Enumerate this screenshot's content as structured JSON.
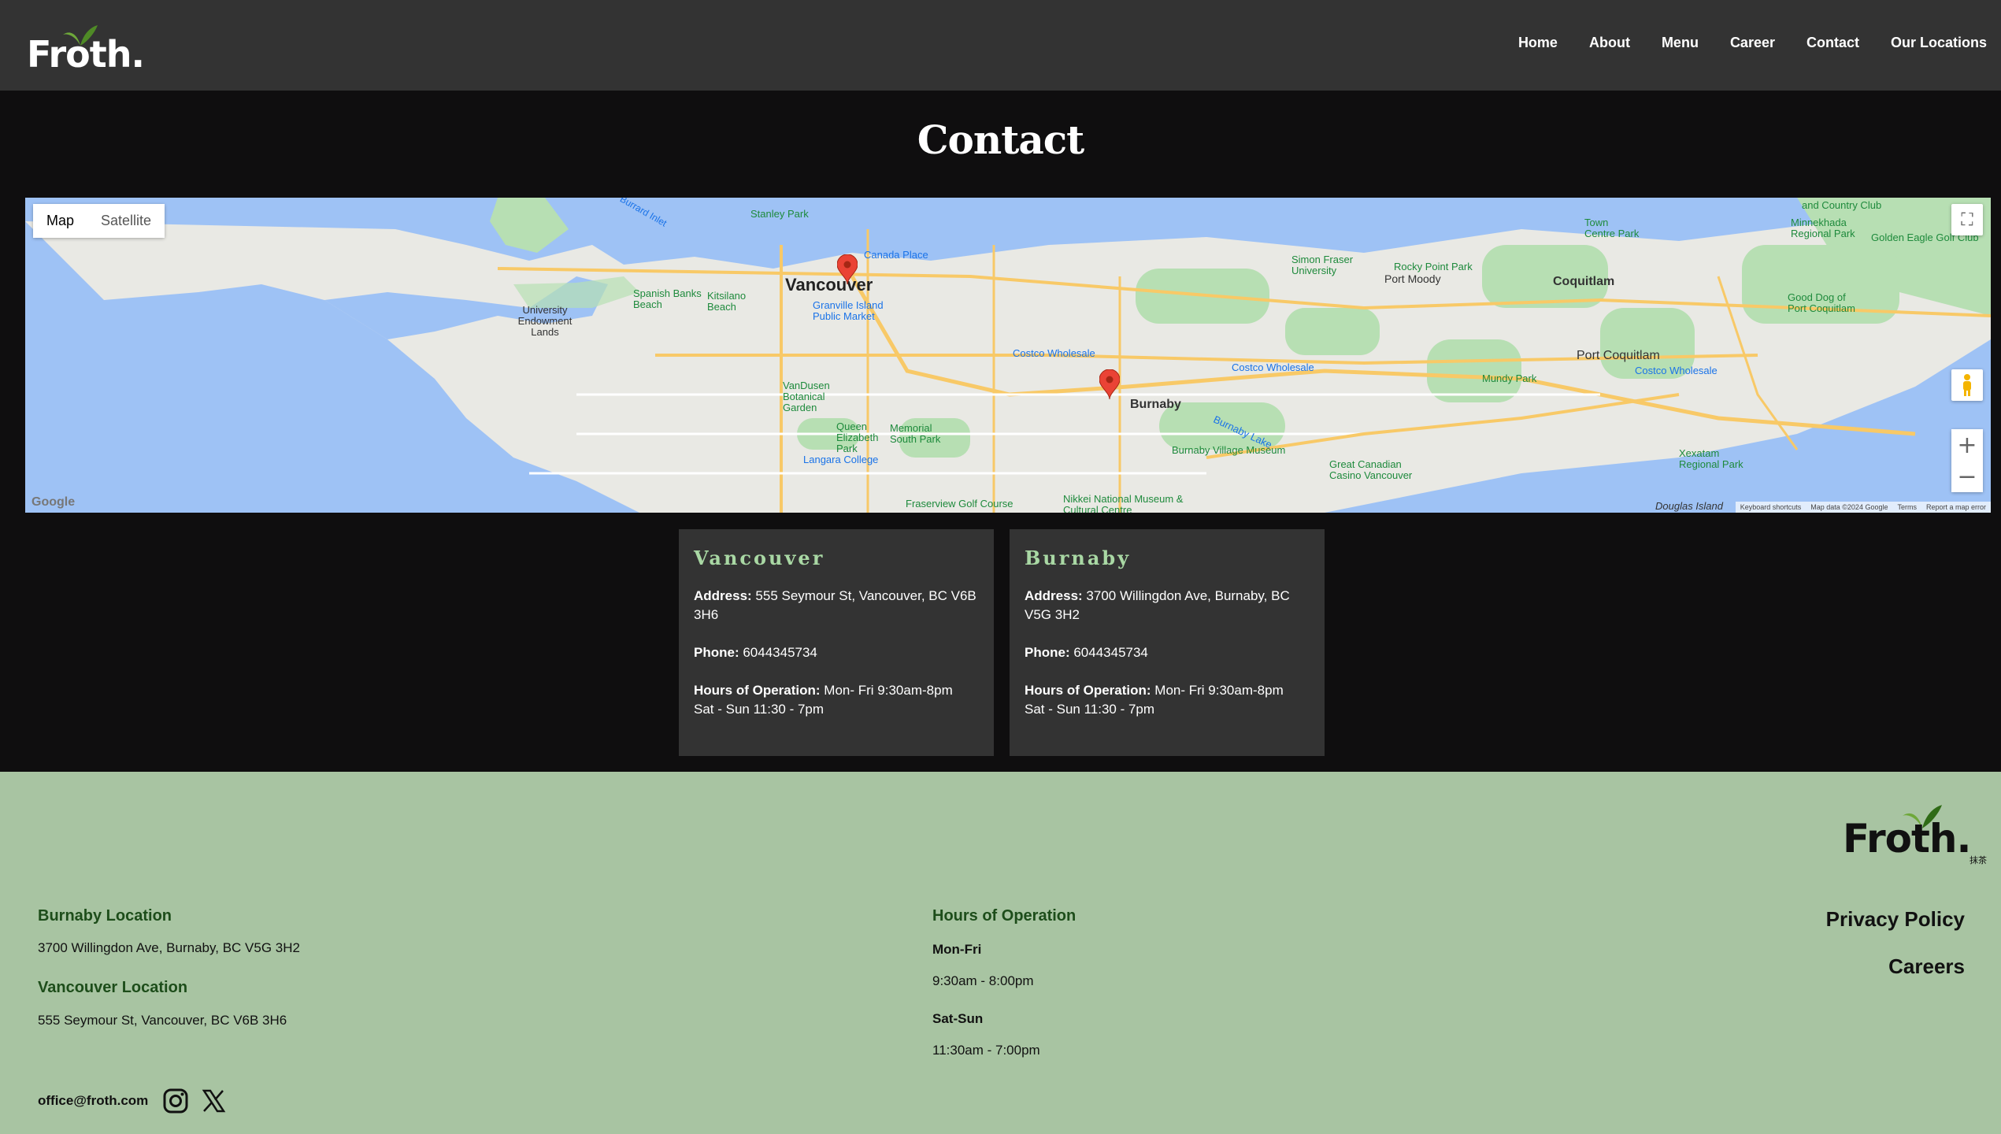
{
  "brand": {
    "name": "Froth.",
    "tagline": "抹茶"
  },
  "nav": {
    "items": [
      "Home",
      "About",
      "Menu",
      "Career",
      "Contact",
      "Our Locations"
    ]
  },
  "page": {
    "title": "Contact"
  },
  "map": {
    "type_map": "Map",
    "type_satellite": "Satellite",
    "attribution": [
      "Keyboard shortcuts",
      "Map data ©2024 Google",
      "Terms",
      "Report a map error"
    ],
    "google_logo": "Google",
    "labels": {
      "vancouver": "Vancouver",
      "burnaby": "Burnaby",
      "coquitlam": "Coquitlam",
      "port_coquitlam": "Port Coquitlam",
      "port_moody": "Port Moody",
      "ubc": "University Endowment Lands",
      "stanley": "Stanley Park",
      "canada_place": "Canada Place",
      "granville": "Granville Island Public Market",
      "spanish_banks": "Spanish Banks Beach",
      "kitsilano": "Kitsilano Beach",
      "vandusen": "VanDusen Botanical Garden",
      "queen_e": "Queen Elizabeth Park",
      "memorial": "Memorial South Park",
      "langara": "Langara College",
      "costco1": "Costco Wholesale",
      "costco2": "Costco Wholesale",
      "costco3": "Costco Wholesale",
      "sfu": "Simon Fraser University",
      "rocky": "Rocky Point Park",
      "burnaby_lake": "Burnaby Lake",
      "burnaby_village": "Burnaby Village Museum",
      "casino": "Great Canadian Casino Vancouver",
      "nikkei": "Nikkei National Museum & Cultural Centre",
      "fraserview": "Fraserview Golf Course",
      "town_centre": "Town Centre Park",
      "mundy": "Mundy Park",
      "xexatam": "Xexatam Regional Park",
      "minnekhada": "Minnekhada Regional Park",
      "golden_eagle": "Golden Eagle Golf Club",
      "good_dog": "Good Dog of Port Coquitlam",
      "country_club": "and Country Club",
      "douglas": "Douglas Island",
      "burrard": "Burrard Inlet"
    }
  },
  "locations": [
    {
      "name": "Vancouver",
      "address_label": "Address:",
      "address": "555 Seymour St, Vancouver, BC V6B 3H6",
      "phone_label": "Phone:",
      "phone": "6044345734",
      "hours_label": "Hours of Operation:",
      "hours_weekday": "Mon- Fri 9:30am-8pm",
      "hours_weekend": "Sat - Sun 11:30 - 7pm"
    },
    {
      "name": "Burnaby",
      "address_label": "Address:",
      "address": "3700 Willingdon Ave, Burnaby, BC V5G 3H2",
      "phone_label": "Phone:",
      "phone": "6044345734",
      "hours_label": "Hours of Operation:",
      "hours_weekday": "Mon- Fri 9:30am-8pm",
      "hours_weekend": "Sat - Sun 11:30 - 7pm"
    }
  ],
  "footer": {
    "burnaby_heading": "Burnaby Location",
    "burnaby_address": "3700 Willingdon Ave, Burnaby, BC V5G 3H2",
    "vancouver_heading": "Vancouver Location",
    "vancouver_address": "555 Seymour St, Vancouver, BC V6B 3H6",
    "hours_heading": "Hours of Operation",
    "weekday_label": "Mon-Fri",
    "weekday_hours": "9:30am - 8:00pm",
    "weekend_label": "Sat-Sun",
    "weekend_hours": "11:30am - 7:00pm",
    "email": "office@froth.com",
    "privacy": "Privacy Policy",
    "careers": "Careers",
    "icons": [
      "instagram-icon",
      "x-icon"
    ]
  },
  "colors": {
    "header_bg": "#333333",
    "page_bg": "#0f0e0f",
    "card_bg": "#333333",
    "accent_green": "#a9d8a4",
    "footer_bg": "#a8c4a2",
    "footer_heading": "#1d4d1a",
    "pin_red": "#ea4335"
  }
}
